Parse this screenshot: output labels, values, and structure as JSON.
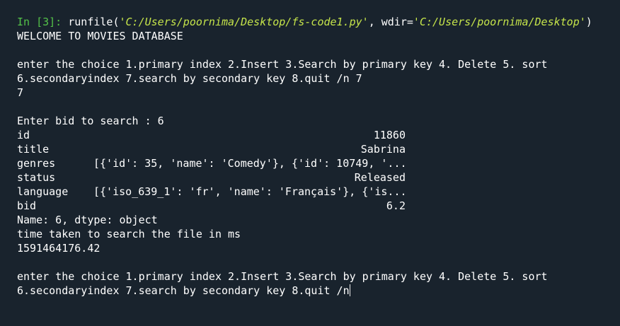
{
  "console": {
    "input_prompt": {
      "label": "In [",
      "number": "3",
      "close": "]:",
      "call": "runfile(",
      "arg1": "'C:/Users/poornima/Desktop/fs-code1.py'",
      "sep": ", wdir=",
      "arg2": "'C:/Users/poornima/Desktop'",
      "end": ")"
    },
    "welcome": "WELCOME TO MOVIES DATABASE",
    "menu_line1": "enter the choice 1.primary index 2.Insert 3.Search by primary key 4. Delete 5. sort",
    "menu_line2_answered": "6.secondaryindex 7.search by secondary key 8.quit /n 7",
    "choice_echo": "7",
    "search_prompt": "Enter bid to search : 6",
    "record": [
      {
        "key": "id",
        "value": "11860",
        "align": "right"
      },
      {
        "key": "title",
        "value": "Sabrina",
        "align": "right"
      },
      {
        "key": "genres",
        "value": "[{'id': 35, 'name': 'Comedy'}, {'id': 10749, '...",
        "align": "left"
      },
      {
        "key": "status",
        "value": "Released",
        "align": "right"
      },
      {
        "key": "language",
        "value": "[{'iso_639_1': 'fr', 'name': 'Français'}, {'is...",
        "align": "left"
      },
      {
        "key": "bid",
        "value": "6.2",
        "align": "right"
      }
    ],
    "series_footer": "Name: 6, dtype: object",
    "time_label": "time taken to search the file in ms",
    "time_value": "1591464176.42",
    "menu_line3": "enter the choice 1.primary index 2.Insert 3.Search by primary key 4. Delete 5. sort",
    "menu_line4_current": "6.secondaryindex 7.search by secondary key 8.quit /n"
  },
  "colors": {
    "background": "#19232d",
    "prompt": "#54c249",
    "string": "#c5e44a",
    "text": "#ffffff"
  }
}
